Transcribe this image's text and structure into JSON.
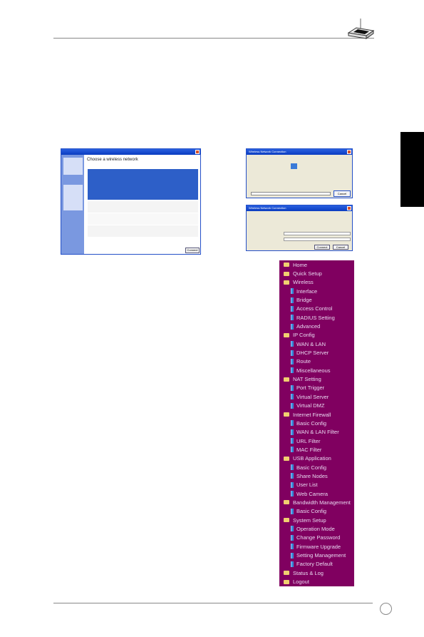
{
  "screens": {
    "left": {
      "heading": "Choose a wireless network",
      "button": "Connect"
    },
    "right_top": {
      "title": "Wireless Network Connection",
      "button": "Cancel"
    },
    "right_bottom": {
      "title": "Wireless Network Connection",
      "buttons": [
        "Connect",
        "Cancel"
      ]
    }
  },
  "menu": {
    "background": "#800060",
    "items": [
      {
        "label": "Home",
        "type": "folder"
      },
      {
        "label": "Quick Setup",
        "type": "folder"
      },
      {
        "label": "Wireless",
        "type": "folder"
      },
      {
        "label": "Interface",
        "type": "page"
      },
      {
        "label": "Bridge",
        "type": "page"
      },
      {
        "label": "Access Control",
        "type": "page"
      },
      {
        "label": "RADIUS Setting",
        "type": "page"
      },
      {
        "label": "Advanced",
        "type": "page"
      },
      {
        "label": "IP Config",
        "type": "folder"
      },
      {
        "label": "WAN & LAN",
        "type": "page"
      },
      {
        "label": "DHCP Server",
        "type": "page"
      },
      {
        "label": "Route",
        "type": "page"
      },
      {
        "label": "Miscellaneous",
        "type": "page"
      },
      {
        "label": "NAT Setting",
        "type": "folder"
      },
      {
        "label": "Port Trigger",
        "type": "page"
      },
      {
        "label": "Virtual Server",
        "type": "page"
      },
      {
        "label": "Virtual DMZ",
        "type": "page"
      },
      {
        "label": "Internet Firewall",
        "type": "folder"
      },
      {
        "label": "Basic Config",
        "type": "page"
      },
      {
        "label": "WAN & LAN Filter",
        "type": "page"
      },
      {
        "label": "URL Filter",
        "type": "page"
      },
      {
        "label": "MAC Filter",
        "type": "page"
      },
      {
        "label": "USB Application",
        "type": "folder"
      },
      {
        "label": "Basic Config",
        "type": "page"
      },
      {
        "label": "Share Nodes",
        "type": "page"
      },
      {
        "label": "User List",
        "type": "page"
      },
      {
        "label": "Web Camera",
        "type": "page"
      },
      {
        "label": "Bandwidth Management",
        "type": "folder"
      },
      {
        "label": "Basic Config",
        "type": "page"
      },
      {
        "label": "System Setup",
        "type": "folder"
      },
      {
        "label": "Operation Mode",
        "type": "page"
      },
      {
        "label": "Change Password",
        "type": "page"
      },
      {
        "label": "Firmware Upgrade",
        "type": "page"
      },
      {
        "label": "Setting Management",
        "type": "page"
      },
      {
        "label": "Factory Default",
        "type": "page"
      },
      {
        "label": "Status & Log",
        "type": "folder"
      },
      {
        "label": "Logout",
        "type": "folder"
      }
    ]
  }
}
